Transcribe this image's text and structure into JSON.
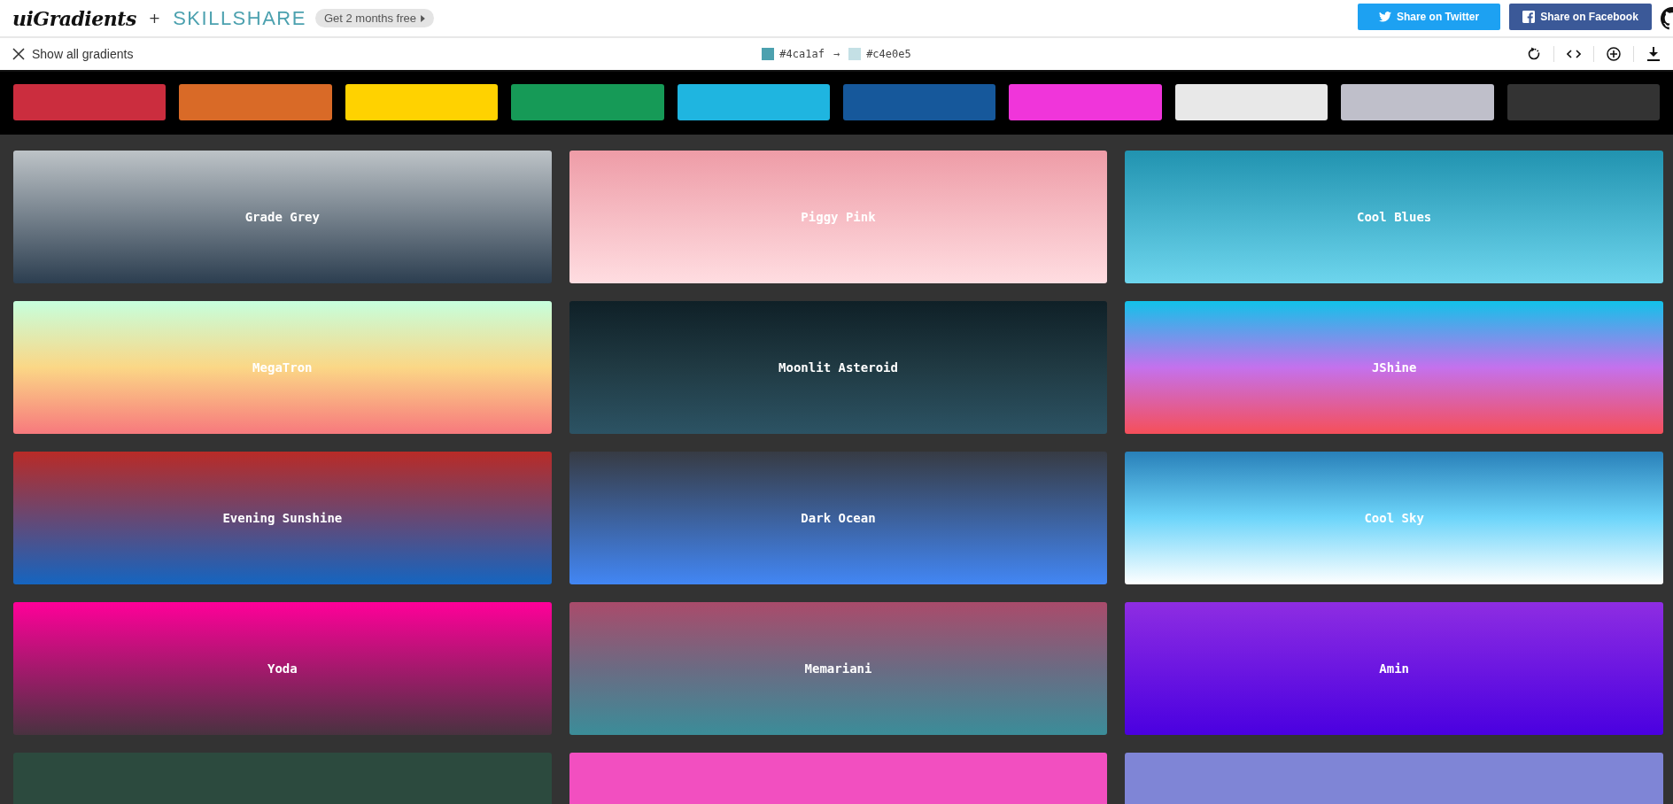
{
  "header": {
    "logo": "uiGradients",
    "plus": "+",
    "partner": "SKILLSHARE",
    "promo": "Get 2 months free",
    "share_buttons": [
      {
        "kind": "twitter",
        "label": "Share on Twitter"
      },
      {
        "kind": "facebook",
        "label": "Share on Facebook"
      }
    ]
  },
  "toolbar": {
    "show_all": "Show all gradients",
    "current": {
      "from": {
        "color": "#4ca1af",
        "label": "#4ca1af"
      },
      "arrow": "→",
      "to": {
        "color": "#c4e0e5",
        "label": "#c4e0e5"
      }
    },
    "actions": [
      {
        "kind": "rotate"
      },
      {
        "kind": "code"
      },
      {
        "kind": "add"
      },
      {
        "kind": "download"
      }
    ]
  },
  "filters": [
    {
      "color": "#cb2d3e"
    },
    {
      "color": "#d96a27"
    },
    {
      "color": "#ffd200"
    },
    {
      "color": "#169a57"
    },
    {
      "color": "#1fb5e0"
    },
    {
      "color": "#16589b"
    },
    {
      "color": "#f035da"
    },
    {
      "color": "#e8e8e8"
    },
    {
      "color": "#bfbfca"
    },
    {
      "color": "#333333"
    }
  ],
  "gradients": [
    {
      "name": "Grade Grey",
      "stops": [
        {
          "color": "#bdc3c7"
        },
        {
          "color": "#2c3e50"
        }
      ]
    },
    {
      "name": "Piggy Pink",
      "stops": [
        {
          "color": "#ee9ca7"
        },
        {
          "color": "#ffdde1"
        }
      ]
    },
    {
      "name": "Cool Blues",
      "stops": [
        {
          "color": "#2193b0"
        },
        {
          "color": "#6dd5ed"
        }
      ]
    },
    {
      "name": "MegaTron",
      "stops": [
        {
          "color": "#c6ffdd"
        },
        {
          "color": "#fbd786"
        },
        {
          "color": "#f7797d"
        }
      ]
    },
    {
      "name": "Moonlit Asteroid",
      "stops": [
        {
          "color": "#0f2027"
        },
        {
          "color": "#203a43"
        },
        {
          "color": "#2c5364"
        }
      ]
    },
    {
      "name": "JShine",
      "stops": [
        {
          "color": "#12c2e9"
        },
        {
          "color": "#c471ed"
        },
        {
          "color": "#f64f59"
        }
      ]
    },
    {
      "name": "Evening Sunshine",
      "stops": [
        {
          "color": "#b92b27"
        },
        {
          "color": "#1565c0"
        }
      ]
    },
    {
      "name": "Dark Ocean",
      "stops": [
        {
          "color": "#373b44"
        },
        {
          "color": "#4286f4"
        }
      ]
    },
    {
      "name": "Cool Sky",
      "stops": [
        {
          "color": "#2980b9"
        },
        {
          "color": "#6dd5fa"
        },
        {
          "color": "#ffffff"
        }
      ]
    },
    {
      "name": "Yoda",
      "stops": [
        {
          "color": "#ff0099"
        },
        {
          "color": "#493240"
        }
      ]
    },
    {
      "name": "Memariani",
      "stops": [
        {
          "color": "#aa4b6b"
        },
        {
          "color": "#6b6b83"
        },
        {
          "color": "#3b8d99"
        }
      ]
    },
    {
      "name": "Amin",
      "stops": [
        {
          "color": "#8e2de2"
        },
        {
          "color": "#4a00e0"
        }
      ]
    },
    {
      "stops": [
        {
          "color": "#2c4a3e"
        }
      ]
    },
    {
      "stops": [
        {
          "color": "#f24fc0"
        }
      ]
    },
    {
      "stops": [
        {
          "color": "#7f85d6"
        }
      ]
    }
  ]
}
